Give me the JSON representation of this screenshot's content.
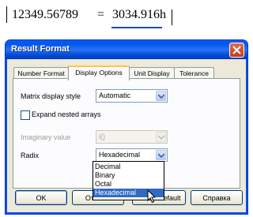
{
  "formula": {
    "lhs": "12349.56789",
    "equals": "=",
    "rhs": "3034.916h"
  },
  "dialog": {
    "title": "Result Format",
    "tabs": [
      {
        "label": "Number Format",
        "active": false
      },
      {
        "label": "Display Options",
        "active": true
      },
      {
        "label": "Unit Display",
        "active": false
      },
      {
        "label": "Tolerance",
        "active": false
      }
    ],
    "matrix_display_style": {
      "label": "Matrix display style",
      "value": "Automatic"
    },
    "expand_nested": {
      "label": "Expand nested arrays",
      "checked": false
    },
    "imaginary_value": {
      "label": "Imaginary value",
      "value": "i()",
      "disabled": true
    },
    "radix": {
      "label": "Radix",
      "value": "Hexadecimal",
      "open": true,
      "options": [
        "Decimal",
        "Binary",
        "Octal",
        "Hexadecimal"
      ],
      "selected_index": 3
    },
    "buttons": {
      "ok": "OK",
      "cancel": "Отмена",
      "set_default": "Set as default",
      "help": "Справка"
    }
  },
  "colors": {
    "titlebar": "#0058ee",
    "selection": "#316ac5",
    "tab_highlight": "#ffc83c"
  },
  "icons": [
    "close-icon",
    "chevron-down-icon",
    "mouse-pointer-icon"
  ]
}
